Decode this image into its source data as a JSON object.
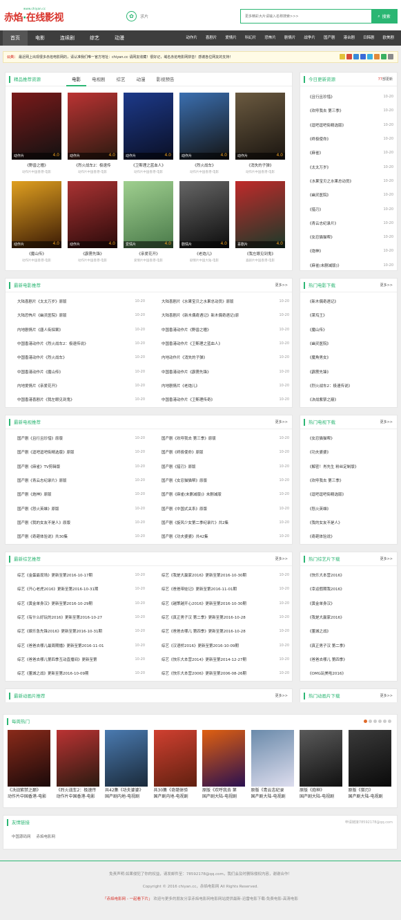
{
  "header": {
    "logo_url": "www.chiyan.cc",
    "logo_main": "赤焰",
    "logo_dot": "·",
    "logo_rest": "在线影视",
    "brand2": "求片",
    "search_placeholder": "更多精彩大片请输入名称搜索>>>",
    "search_button": "搜索"
  },
  "nav": {
    "main": [
      "首页",
      "电影",
      "连续剧",
      "综艺",
      "动漫"
    ],
    "sub": [
      "动作片",
      "喜剧片",
      "爱情片",
      "科幻片",
      "恐怖片",
      "剧情片",
      "战争片",
      "国产剧",
      "港台剧",
      "日韩剧",
      "欧美剧"
    ]
  },
  "notice": {
    "label": "公共：",
    "text": "最近网上出现很多赤焰电影网的，请认准我们唯一官方地址：chiyan.cc 请网友收藏！很好记，域名赤焰电影网拼音！感谢各位网友的支持！"
  },
  "featured": {
    "title": "精品推荐资源",
    "tabs": [
      "电影",
      "电视剧",
      "综艺",
      "动漫",
      "影视预告"
    ],
    "movies": [
      {
        "name": "《野兽之瞳》",
        "genre": "动作片",
        "score": "4.0",
        "actors": "动作片中国香港-电影",
        "c1": "#7a1a1a",
        "c2": "#111"
      },
      {
        "name": "《烈火战车2：极速传",
        "genre": "动作片",
        "score": "4.0",
        "actors": "动作片中国香港-电影",
        "c1": "#b33",
        "c2": "#2a1a10"
      },
      {
        "name": "《卫斯理之蓝血人》",
        "genre": "动作片",
        "score": "4.0",
        "actors": "动作片中国香港-电影",
        "c1": "#1d3a8a",
        "c2": "#0a0f25"
      },
      {
        "name": "《烈火战车》",
        "genre": "动作片",
        "score": "4.0",
        "actors": "动作片中国香港-电影",
        "c1": "#3b6fb0",
        "c2": "#141414"
      },
      {
        "name": "《消失的子弹》",
        "genre": "动作片",
        "score": "4.0",
        "actors": "动作片中国香港-电影",
        "c1": "#6b5a40",
        "c2": "#1a1510"
      },
      {
        "name": "《魔山传》",
        "genre": "动作片",
        "score": "4.0",
        "actors": "动作片中国香港-电影",
        "c1": "#e0a020",
        "c2": "#3a1a05"
      },
      {
        "name": "《霹雳先锋》",
        "genre": "动作片",
        "score": "4.0",
        "actors": "动作片中国香港-电影",
        "c1": "#a33",
        "c2": "#2a0a0a"
      },
      {
        "name": "《亲爱花开》",
        "genre": "爱情片",
        "score": "4.0",
        "actors": "爱情片中国香港-电影",
        "c1": "#9fcf8f",
        "c2": "#4a7a4a"
      },
      {
        "name": "《老炮儿》",
        "genre": "剧情片",
        "score": "4.0",
        "actors": "剧情片中国大陆-电影",
        "c1": "#666",
        "c2": "#0d0d0d"
      },
      {
        "name": "《我左眼见到鬼》",
        "genre": "喜剧片",
        "score": "4.0",
        "actors": "喜剧片中国香港-电影",
        "c1": "#c02a2a",
        "c2": "#1a3a2a"
      }
    ]
  },
  "today": {
    "title": "今日更新资源",
    "count": "77",
    "count_suffix": "部更新",
    "items": [
      {
        "name": "《且行且珍惜》",
        "date": "10-20"
      },
      {
        "name": "《欢呼我去 第三季》",
        "date": "10-20"
      },
      {
        "name": "《逗吧逗吧街精选版》",
        "date": "10-20"
      },
      {
        "name": "《终极使命》",
        "date": "10-20"
      },
      {
        "name": "《麻雀》",
        "date": "10-20"
      },
      {
        "name": "《太太万岁》",
        "date": "10-20"
      },
      {
        "name": "《水果宝贝之水果总动员》",
        "date": "10-20"
      },
      {
        "name": "《幽灵医院》",
        "date": "10-20"
      },
      {
        "name": "《猎刃》",
        "date": "10-20"
      },
      {
        "name": "《青云志纪录片》",
        "date": "10-20"
      },
      {
        "name": "《女忍猫猫帮》",
        "date": "10-20"
      },
      {
        "name": "《炮神》",
        "date": "10-20"
      },
      {
        "name": "《麻雀(未删减版)》",
        "date": "10-20"
      }
    ]
  },
  "new_movies": {
    "title": "最新电影推荐",
    "more": "更多>>",
    "left": [
      {
        "name": "大陆喜剧片《太太万岁》原版",
        "date": "10-20"
      },
      {
        "name": "大陆恐怖片《幽灵医院》原版",
        "date": "10-20"
      },
      {
        "name": "内地剧情片《唐人街探案》",
        "date": "10-20"
      },
      {
        "name": "中国香港动作片《烈火战车2：极速传说》",
        "date": "10-20"
      },
      {
        "name": "中国香港动作片《烈火战车》",
        "date": "10-20"
      },
      {
        "name": "中国香港动作片《魔山传》",
        "date": "10-20"
      },
      {
        "name": "内地爱情片《亲爱花开》",
        "date": "10-20"
      },
      {
        "name": "中国香港喜剧片《我左眼见到鬼》",
        "date": "10-20"
      }
    ],
    "right": [
      {
        "name": "大陆喜剧片《水果宝贝之水果总动员》原版",
        "date": "10-20"
      },
      {
        "name": "大陆喜剧片《新木偶奇遇记》新木偶奇遇记(原",
        "date": "10-20"
      },
      {
        "name": "中国香港动作片《野兽之瞳》",
        "date": "10-20"
      },
      {
        "name": "中国香港动作片《卫斯理之蓝血人》",
        "date": "10-20"
      },
      {
        "name": "内地动作片《消失的子弹》",
        "date": "10-20"
      },
      {
        "name": "中国香港动作片《霹雳先锋》",
        "date": "10-20"
      },
      {
        "name": "内地剧情片《老炮儿》",
        "date": "10-20"
      },
      {
        "name": "中国香港动作片《卫斯理传奇》",
        "date": "10-20"
      }
    ]
  },
  "hot_movies": {
    "title": "热门电影下载",
    "more": "更多>>",
    "items": [
      "《新木偶奇遇记》",
      "《莱坞王》",
      "《魔山传》",
      "《幽灵医院》",
      "《魔角男女》",
      "《霹雳先锋》",
      "《烈火战车2：极速传说》",
      "《决战紫禁之巅》"
    ]
  },
  "new_tv": {
    "title": "最新电视推荐",
    "more": "更多>>",
    "left": [
      {
        "name": "国产剧《且行且珍惜》原版",
        "date": "10-20"
      },
      {
        "name": "国产剧《逗吧逗吧街精选版》原版",
        "date": "10-20"
      },
      {
        "name": "国产剧《麻雀》TV剪辑版",
        "date": "10-20"
      },
      {
        "name": "国产剧《青云志纪录片》原版",
        "date": "10-20"
      },
      {
        "name": "国产剧《炮神》原版",
        "date": "10-20"
      },
      {
        "name": "国产剧《怒火英雄》原版",
        "date": "10-20"
      },
      {
        "name": "国产剧《我的女友不是人》原版",
        "date": "10-20"
      },
      {
        "name": "国产剧《奇葩体验说》共30集",
        "date": "10-20"
      }
    ],
    "right": [
      {
        "name": "国产剧《欢呼我去 第三季》原版",
        "date": "10-20"
      },
      {
        "name": "国产剧《终极使命》原版",
        "date": "10-20"
      },
      {
        "name": "国产剧《猎刃》原版",
        "date": "10-20"
      },
      {
        "name": "国产剧《女忍猫猫帮》原版",
        "date": "10-20"
      },
      {
        "name": "国产剧《麻雀(未删减版)》未删减版",
        "date": "10-20"
      },
      {
        "name": "国产剧《中国式关系》原版",
        "date": "10-20"
      },
      {
        "name": "国产剧《旋风少女第二季纪录片》共2集",
        "date": "10-20"
      },
      {
        "name": "国产剧《功夫婆婆》共42集",
        "date": "10-20"
      }
    ]
  },
  "hot_tv": {
    "title": "热门电视下载",
    "more": "更多>>",
    "items": [
      "《女忍猫猫帮》",
      "《功夫婆婆》",
      "《解密！肖先生 粉丝定制版》",
      "《欢呼我去 第三季》",
      "《逗吧逗吧街精选版》",
      "《怒火英雄》",
      "《我的女友不是人》",
      "《奇葩体验说》"
    ]
  },
  "new_variety": {
    "title": "最新综艺推荐",
    "more": "更多>>",
    "left": [
      {
        "name": "综艺《金蛋最现场》更新至第2016-10-17期",
        "date": "10-20"
      },
      {
        "name": "综艺《开心老虎2016》更新至第2016-10-31期",
        "date": "10-20"
      },
      {
        "name": "综艺《黄金单身汉》更新至第2016-10-29期",
        "date": "10-20"
      },
      {
        "name": "综艺《有什么好玩的2016》更新至第2016-10-27",
        "date": "10-20"
      },
      {
        "name": "综艺《娱乐急先锋2016》更新至第2016-10-31期",
        "date": "10-20"
      },
      {
        "name": "综艺《爸爸去哪儿最周期播》更新至第2016-11-01",
        "date": "10-20"
      },
      {
        "name": "综艺《爸爸去哪儿第四季互动直播间》更新至第",
        "date": "10-20"
      },
      {
        "name": "综艺《董城之战》更新至第2016-10-09期",
        "date": "10-20"
      }
    ],
    "right": [
      {
        "name": "综艺《我是大赢家2016》更新至第2016-10-30期",
        "date": "10-20"
      },
      {
        "name": "综艺《爸爸带娃记》更新至第2016-11-01期",
        "date": "10-20"
      },
      {
        "name": "综艺《越策越开心2016》更新至第2016-10-30期",
        "date": "10-20"
      },
      {
        "name": "综艺《真正男子汉 第二季》更新至第2016-10-28",
        "date": "10-20"
      },
      {
        "name": "综艺《爸爸去哪儿 第四季》更新至第2016-10-28",
        "date": "10-20"
      },
      {
        "name": "综艺《汉语桥2016》更新至第2016-10-09期",
        "date": "10-20"
      },
      {
        "name": "综艺《快乐大本营2014》更新至第2014-12-27期",
        "date": "10-20"
      },
      {
        "name": "综艺《快乐大本营2006》更新至第2006-08-26期",
        "date": "10-20"
      }
    ]
  },
  "hot_variety": {
    "title": "热门综艺片下载",
    "more": "更多>>",
    "items": [
      "《快乐大本营2016》",
      "《幸运假期我2016》",
      "《黄金单身汉》",
      "《我是大赢家2016》",
      "《董城之战》",
      "《真正男子汉 第二季》",
      "《爸爸去哪儿 第四季》",
      "《OMG玩美啦2016》"
    ]
  },
  "new_anime": {
    "title": "最新动画片推荐",
    "more": "更多>>"
  },
  "hot_anime": {
    "title": "热门动画片下载",
    "more": "更多>>"
  },
  "weekly": {
    "title": "每周热门",
    "items": [
      {
        "name": "《决战紫禁之巅》",
        "actors": "动作片中国香港-电影",
        "c1": "#8a2a1a",
        "c2": "#1a0a0a"
      },
      {
        "name": "《烈火战车2：极速传",
        "actors": "动作片中国香港-电影",
        "c1": "#b33",
        "c2": "#2a1a10"
      },
      {
        "name": "共42集《功夫婆婆》",
        "actors": "国产剧内地-电视剧",
        "c1": "#4a7ab0",
        "c2": "#1a2a3a"
      },
      {
        "name": "共30集《奇葩体验",
        "actors": "国产剧内地-电视剧",
        "c1": "#d04030",
        "c2": "#602010"
      },
      {
        "name": "原版《欢呼我去 第",
        "actors": "国产剧大陆-电视剧",
        "c1": "#e06010",
        "c2": "#2a1050"
      },
      {
        "name": "原版《青云志纪录",
        "actors": "国产剧大陆-电视剧",
        "c1": "#6a8aaa",
        "c2": "#dde"
      },
      {
        "name": "原版《炮神》",
        "actors": "国产剧大陆-电视剧",
        "c1": "#5a5a5a",
        "c2": "#111"
      },
      {
        "name": "原版《猎刃》",
        "actors": "国产剧大陆-电视剧",
        "c1": "#3a3a3a",
        "c2": "#0a0a0a"
      }
    ]
  },
  "links": {
    "title": "友情链接",
    "contact": "申请链接78592178@qq.com",
    "items": [
      "中国源码网",
      "赤焰电影网"
    ]
  },
  "footer": {
    "line1": "免责声明:如果侵犯了你的权益，请发邮件至：78592178@qq.com，我们会及时删除侵权内容，谢谢合作！",
    "line2": "Copyright © 2016 chiyan.cc，赤焰电影网 All Rights Reserved.",
    "line3_hl": "「赤焰电影网 - 一起看下片」",
    "line3": "欢迎与更多的朋友分享赤焰电影网电影网站提供最新-迅雷电影下载-免费电影-高清电影"
  }
}
